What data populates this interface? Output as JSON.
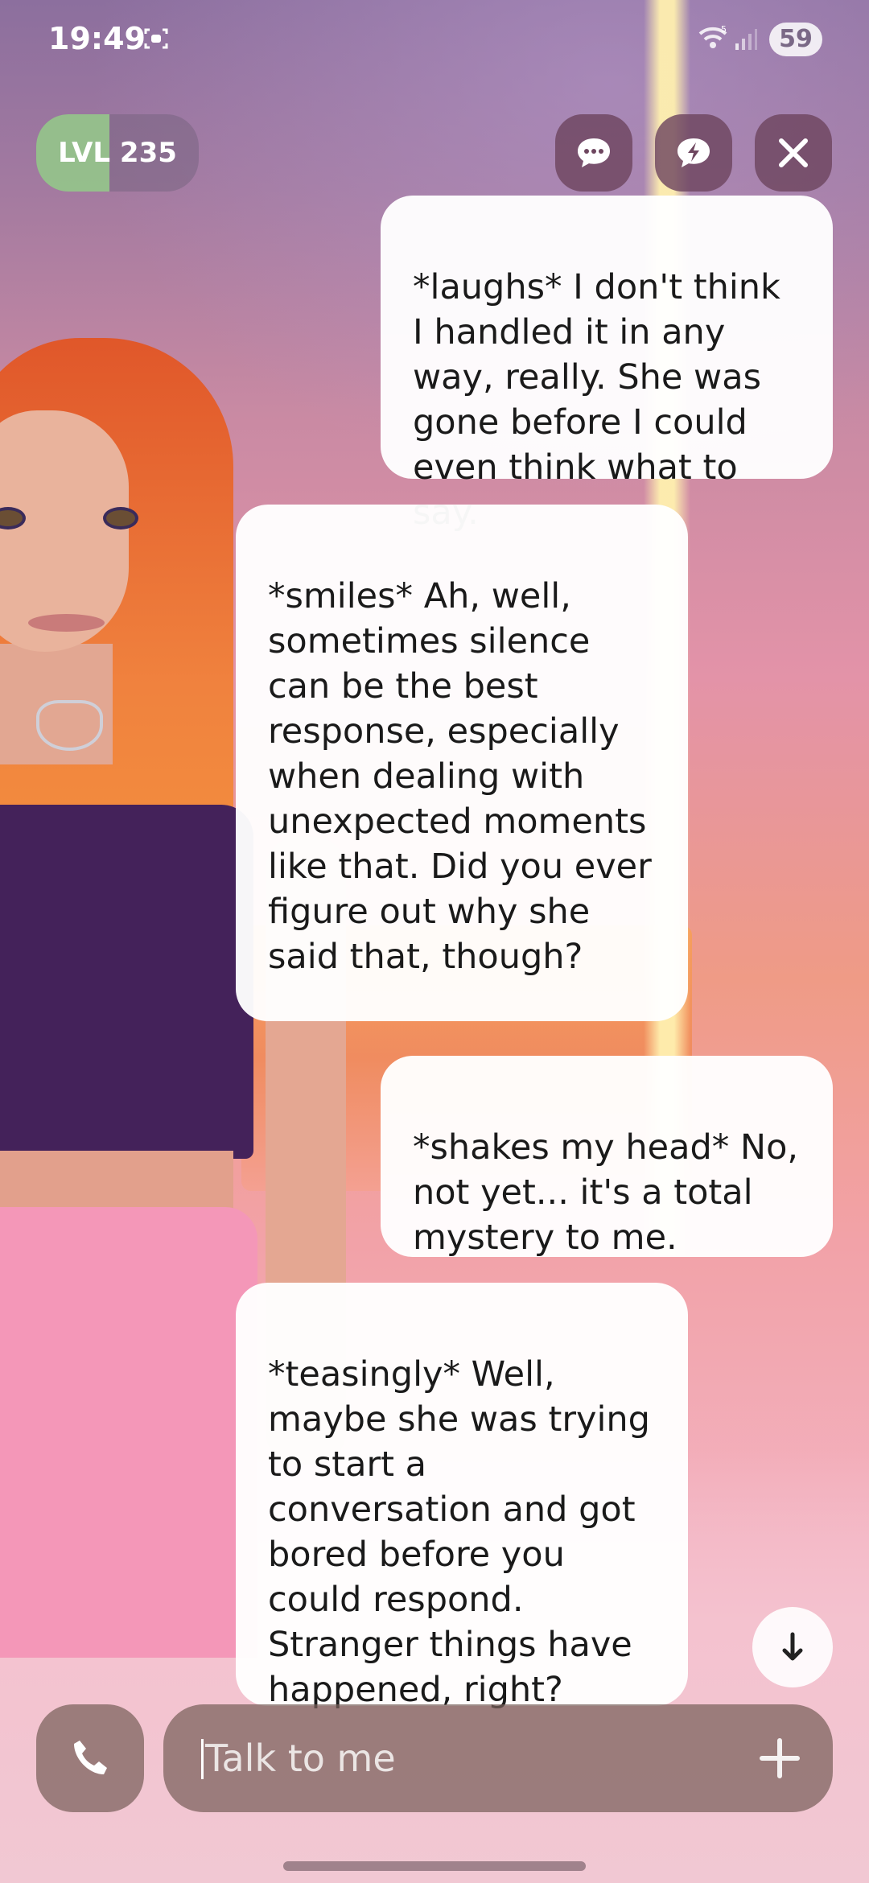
{
  "status_bar": {
    "time": "19:49",
    "battery": "59",
    "wifi_badge": "5"
  },
  "header": {
    "level_label": "LVL 235",
    "level_progress_percent": 45,
    "buttons": [
      "chat-icon",
      "lightning-chat-icon",
      "close-icon"
    ]
  },
  "messages": [
    {
      "sender": "user",
      "text": "*laughs* I don't think I handled it in any way, really. She was gone before I could even think what to say."
    },
    {
      "sender": "bot",
      "text": "*smiles* Ah, well, sometimes silence can be the best response, especially when dealing with unexpected moments like that. Did you ever figure out why she said that, though?"
    },
    {
      "sender": "user",
      "text": "*shakes my head* No, not yet... it's a total mystery to me."
    },
    {
      "sender": "bot",
      "text": "*teasingly* Well, maybe she was trying to start a conversation and got bored before you could respond. Stranger things have happened, right?"
    }
  ],
  "input": {
    "placeholder": "Talk to me"
  },
  "colors": {
    "bubble": "#ffffff",
    "control_bg": "#6e465f",
    "level_fill": "#96c38c"
  }
}
